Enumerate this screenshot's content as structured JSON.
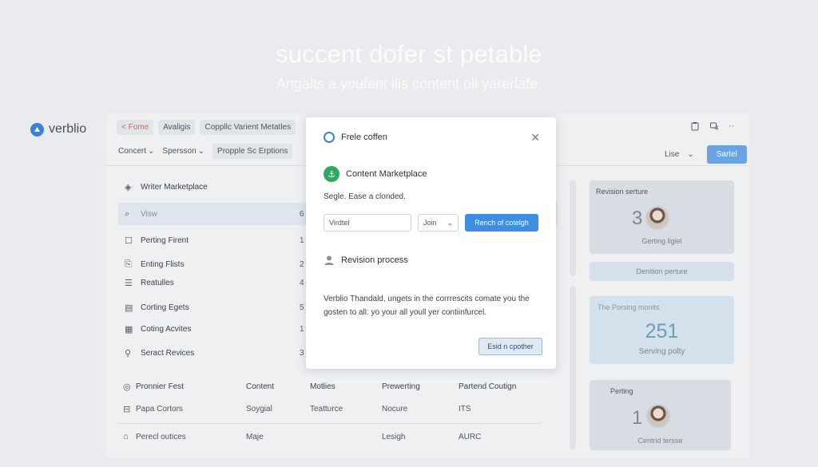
{
  "hero": {
    "title": "succent dofer st petable",
    "subtitle": "Angalts a youfent llis content oll yarerlafe."
  },
  "brand": {
    "name": "verblio",
    "logo_icon": "verblio-logo-icon"
  },
  "topbar": {
    "home": "< Fome",
    "tabs": [
      "Avaligis",
      "Coppllc Varient Metatles"
    ]
  },
  "filters": {
    "concert": "Concert",
    "spersson": "Spersson",
    "chip": "Propple Sc Erptions"
  },
  "right_controls": {
    "lise": "Lise",
    "button": "Sartel"
  },
  "list": {
    "header": "Writer Marketplace",
    "items": [
      {
        "label": "Visw",
        "num": "6",
        "icon": "search-icon"
      },
      {
        "label": "Perting Firent",
        "num": "1",
        "icon": "square-icon"
      },
      {
        "label": "Enting Flists",
        "num": "2",
        "icon": "document-icon"
      },
      {
        "label": "Reatulles",
        "num": "4",
        "icon": "list-icon"
      },
      {
        "label": "Corting Egets",
        "num": "5",
        "icon": "card-icon"
      },
      {
        "label": "Coting Acvites",
        "num": "1",
        "icon": "grid-icon"
      },
      {
        "label": "Seract Revices",
        "num": "3",
        "icon": "link-icon"
      }
    ]
  },
  "table": {
    "headers": [
      "Pronnier Fest",
      "Content",
      "Motlies",
      "Prewerting",
      "Partend Coutign"
    ],
    "rows": [
      [
        "Papa Cortors",
        "Soygial",
        "Teatturce",
        "Nocure",
        "ITS"
      ],
      [
        "Perecl outices",
        "Maje",
        "",
        "Lesigh",
        "AURC"
      ]
    ]
  },
  "cards": {
    "revision": {
      "title": "Revision serture",
      "value": "3",
      "sub": "Gerting ligiel"
    },
    "flat": {
      "label": "Denition perture"
    },
    "blue": {
      "title": "The Porsing monits",
      "value": "251",
      "sub": "Serving polty"
    },
    "bottom": {
      "title": "Perting",
      "value": "1",
      "sub": "Centrid tersse"
    }
  },
  "modal": {
    "title": "Frele coffen",
    "section1": "Content Marketplace",
    "section1_text": "Segle. Ease a clonded.",
    "input_value": "Virdtel",
    "select_value": "Join",
    "button_blue": "Rench of cotelgh",
    "section2": "Revision process",
    "paragraph": "Verblio Thandald, ungets in the corrrescits comate you the gosten to all: yo your all youll yer contiinfurcel.",
    "button_outline": "Esid n cpother"
  },
  "colors": {
    "accent": "#3d8ee0",
    "green": "#2ea764",
    "background": "#e9ebee"
  }
}
